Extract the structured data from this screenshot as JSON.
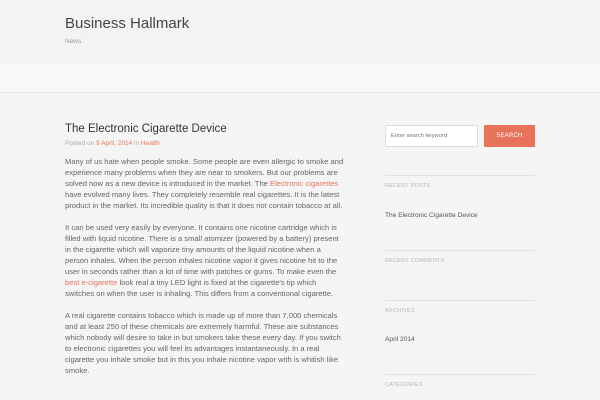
{
  "site": {
    "title": "Business Hallmark",
    "description": "News"
  },
  "post": {
    "title": "The Electronic Cigarette Device",
    "meta": {
      "prefix": "Posted on",
      "date": "9 April, 2014",
      "in_word": "in",
      "category": "Health"
    },
    "paragraphs": [
      {
        "before": "Many of us hate when people smoke. Some people are even allergic to smoke and experience many problems when they are near to smokers. But our problems are solved now as a new device is introduced in the market. The ",
        "link": "Electronic cigarettes",
        "after": " have evolved many lives. They completely resemble real cigarettes. It is the latest product in the market. Its incredible quality is that it does not contain tobacco at all."
      },
      {
        "before": "It can be used very easily by everyone. It contains one nicotine cartridge which is filled with liquid nicotine. There is a small atomizer (powered by a battery) present in the cigarette which will vaporize tiny amounts of the liquid nicotine when a person inhales. When the person inhales nicotine vapor it gives nicotine hit to the user in seconds rather than a lot of time with patches or gums. To make even the ",
        "link": "best e-cigarette",
        "after": " look real a tiny LED light is fixed at the cigarette's tip which switches on when the user is inhaling. This differs from a conventional cigarette."
      },
      {
        "text": "A real cigarette contains tobacco which is made up of more than 7,000 chemicals and at least 250 of these chemicals are extremely harmful. These are substances which nobody will desire to take in but smokers take these every day. If you switch to electronic cigarettes you will feel its advantages instantaneously. In a real cigarette you inhale smoke but in this you inhale nicotine vapor with is whitish like smoke."
      }
    ]
  },
  "sidebar": {
    "search": {
      "placeholder": "Enter search keyword",
      "button_label": "SEARCH"
    },
    "recent_posts": {
      "heading": "RECENT POSTS",
      "items": [
        "The Electronic Cigarette Device"
      ]
    },
    "recent_comments": {
      "heading": "RECENT COMMENTS"
    },
    "archives": {
      "heading": "ARCHIVES",
      "items": [
        "April 2014"
      ]
    },
    "categories": {
      "heading": "CATEGORIES"
    }
  },
  "colors": {
    "accent": "#e8735a",
    "background": "#f3f3f3",
    "text": "#555555"
  }
}
